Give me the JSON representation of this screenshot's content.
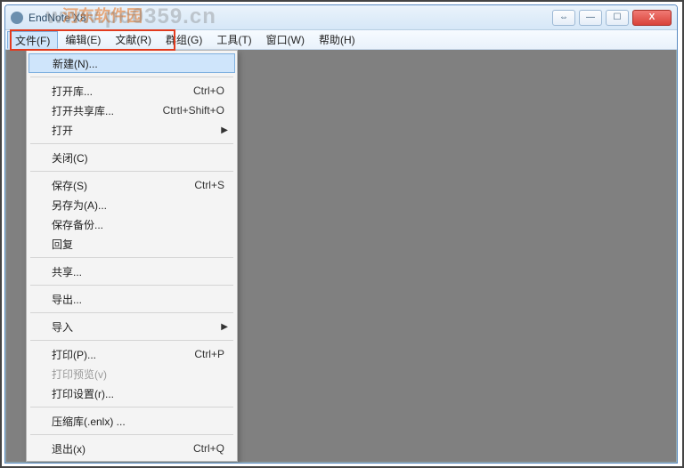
{
  "window": {
    "title": "EndNote X8"
  },
  "menubar": {
    "items": [
      {
        "label": "文件(F)"
      },
      {
        "label": "编辑(E)"
      },
      {
        "label": "文献(R)"
      },
      {
        "label": "群组(G)"
      },
      {
        "label": "工具(T)"
      },
      {
        "label": "窗口(W)"
      },
      {
        "label": "帮助(H)"
      }
    ]
  },
  "dropdown": {
    "groups": [
      [
        {
          "label": "新建(N)...",
          "highlight": true
        }
      ],
      [
        {
          "label": "打开库...",
          "shortcut": "Ctrl+O"
        },
        {
          "label": "打开共享库...",
          "shortcut": "Ctrtl+Shift+O"
        },
        {
          "label": "打开",
          "submenu": true
        }
      ],
      [
        {
          "label": "关闭(C)"
        }
      ],
      [
        {
          "label": "保存(S)",
          "shortcut": "Ctrl+S"
        },
        {
          "label": "另存为(A)..."
        },
        {
          "label": "保存备份..."
        },
        {
          "label": "回复"
        }
      ],
      [
        {
          "label": "共享..."
        }
      ],
      [
        {
          "label": "导出..."
        }
      ],
      [
        {
          "label": "导入",
          "submenu": true
        }
      ],
      [
        {
          "label": "打印(P)...",
          "shortcut": "Ctrl+P"
        },
        {
          "label": "打印预览(v)",
          "disabled": true
        },
        {
          "label": "打印设置(r)..."
        }
      ],
      [
        {
          "label": "压缩库(.enlx) ..."
        }
      ],
      [
        {
          "label": "退出(x)",
          "shortcut": "Ctrl+Q"
        }
      ]
    ]
  },
  "watermark": {
    "text1": "www.pc0359.cn",
    "text2": "河东软件园"
  },
  "titlebuttons": {
    "doublearrow": "⇔",
    "min": "—",
    "max": "☐",
    "close": "X"
  }
}
